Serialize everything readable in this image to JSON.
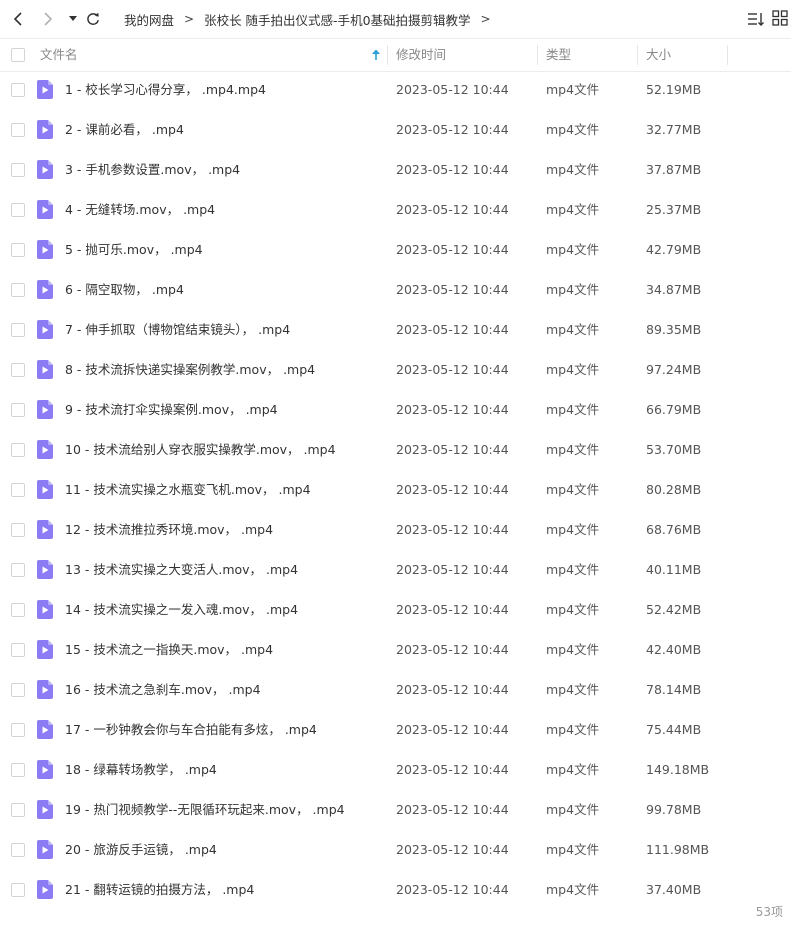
{
  "nav": {
    "back_icon": "chevron-left-icon",
    "forward_icon": "chevron-right-icon",
    "dropdown_icon": "caret-down-icon",
    "refresh_icon": "refresh-icon"
  },
  "breadcrumb": {
    "root": "我的网盘",
    "folder": "张校长 随手拍出仪式感-手机0基础拍摄剪辑教学",
    "separator": ">"
  },
  "toolbar": {
    "sort_icon": "sort-list-icon",
    "grid_icon": "grid-view-icon"
  },
  "table": {
    "headers": {
      "name": "文件名",
      "modified": "修改时间",
      "type": "类型",
      "size": "大小"
    },
    "sort_icon": "sort-up-arrow-icon",
    "accent_color": "#2a9fd6",
    "file_icon_color": "#8b7cf6",
    "rows": [
      {
        "name": "1 - 校长学习心得分享，  .mp4.mp4",
        "modified": "2023-05-12 10:44",
        "type": "mp4文件",
        "size": "52.19MB"
      },
      {
        "name": "2 - 课前必看，  .mp4",
        "modified": "2023-05-12 10:44",
        "type": "mp4文件",
        "size": "32.77MB"
      },
      {
        "name": "3 - 手机参数设置.mov，  .mp4",
        "modified": "2023-05-12 10:44",
        "type": "mp4文件",
        "size": "37.87MB"
      },
      {
        "name": "4 - 无缝转场.mov，  .mp4",
        "modified": "2023-05-12 10:44",
        "type": "mp4文件",
        "size": "25.37MB"
      },
      {
        "name": "5 - 抛可乐.mov，  .mp4",
        "modified": "2023-05-12 10:44",
        "type": "mp4文件",
        "size": "42.79MB"
      },
      {
        "name": "6 - 隔空取物，  .mp4",
        "modified": "2023-05-12 10:44",
        "type": "mp4文件",
        "size": "34.87MB"
      },
      {
        "name": "7 - 伸手抓取（博物馆结束镜头），  .mp4",
        "modified": "2023-05-12 10:44",
        "type": "mp4文件",
        "size": "89.35MB"
      },
      {
        "name": "8 - 技术流拆快递实操案例教学.mov，  .mp4",
        "modified": "2023-05-12 10:44",
        "type": "mp4文件",
        "size": "97.24MB"
      },
      {
        "name": "9 - 技术流打伞实操案例.mov，  .mp4",
        "modified": "2023-05-12 10:44",
        "type": "mp4文件",
        "size": "66.79MB"
      },
      {
        "name": "10 - 技术流给别人穿衣服实操教学.mov，  .mp4",
        "modified": "2023-05-12 10:44",
        "type": "mp4文件",
        "size": "53.70MB"
      },
      {
        "name": "11 - 技术流实操之水瓶变飞机.mov，  .mp4",
        "modified": "2023-05-12 10:44",
        "type": "mp4文件",
        "size": "80.28MB"
      },
      {
        "name": "12 - 技术流推拉秀环境.mov，  .mp4",
        "modified": "2023-05-12 10:44",
        "type": "mp4文件",
        "size": "68.76MB"
      },
      {
        "name": "13 - 技术流实操之大变活人.mov，  .mp4",
        "modified": "2023-05-12 10:44",
        "type": "mp4文件",
        "size": "40.11MB"
      },
      {
        "name": "14 - 技术流实操之一发入魂.mov，  .mp4",
        "modified": "2023-05-12 10:44",
        "type": "mp4文件",
        "size": "52.42MB"
      },
      {
        "name": "15 - 技术流之一指换天.mov，  .mp4",
        "modified": "2023-05-12 10:44",
        "type": "mp4文件",
        "size": "42.40MB"
      },
      {
        "name": "16 - 技术流之急刹车.mov，  .mp4",
        "modified": "2023-05-12 10:44",
        "type": "mp4文件",
        "size": "78.14MB"
      },
      {
        "name": "17 - 一秒钟教会你与车合拍能有多炫，  .mp4",
        "modified": "2023-05-12 10:44",
        "type": "mp4文件",
        "size": "75.44MB"
      },
      {
        "name": "18 - 绿幕转场教学，  .mp4",
        "modified": "2023-05-12 10:44",
        "type": "mp4文件",
        "size": "149.18MB"
      },
      {
        "name": "19 - 热门视频教学--无限循环玩起来.mov，  .mp4",
        "modified": "2023-05-12 10:44",
        "type": "mp4文件",
        "size": "99.78MB"
      },
      {
        "name": "20 - 旅游反手运镜，  .mp4",
        "modified": "2023-05-12 10:44",
        "type": "mp4文件",
        "size": "111.98MB"
      },
      {
        "name": "21 - 翻转运镜的拍摄方法，  .mp4",
        "modified": "2023-05-12 10:44",
        "type": "mp4文件",
        "size": "37.40MB"
      }
    ]
  },
  "footer": {
    "item_count": "53项"
  }
}
